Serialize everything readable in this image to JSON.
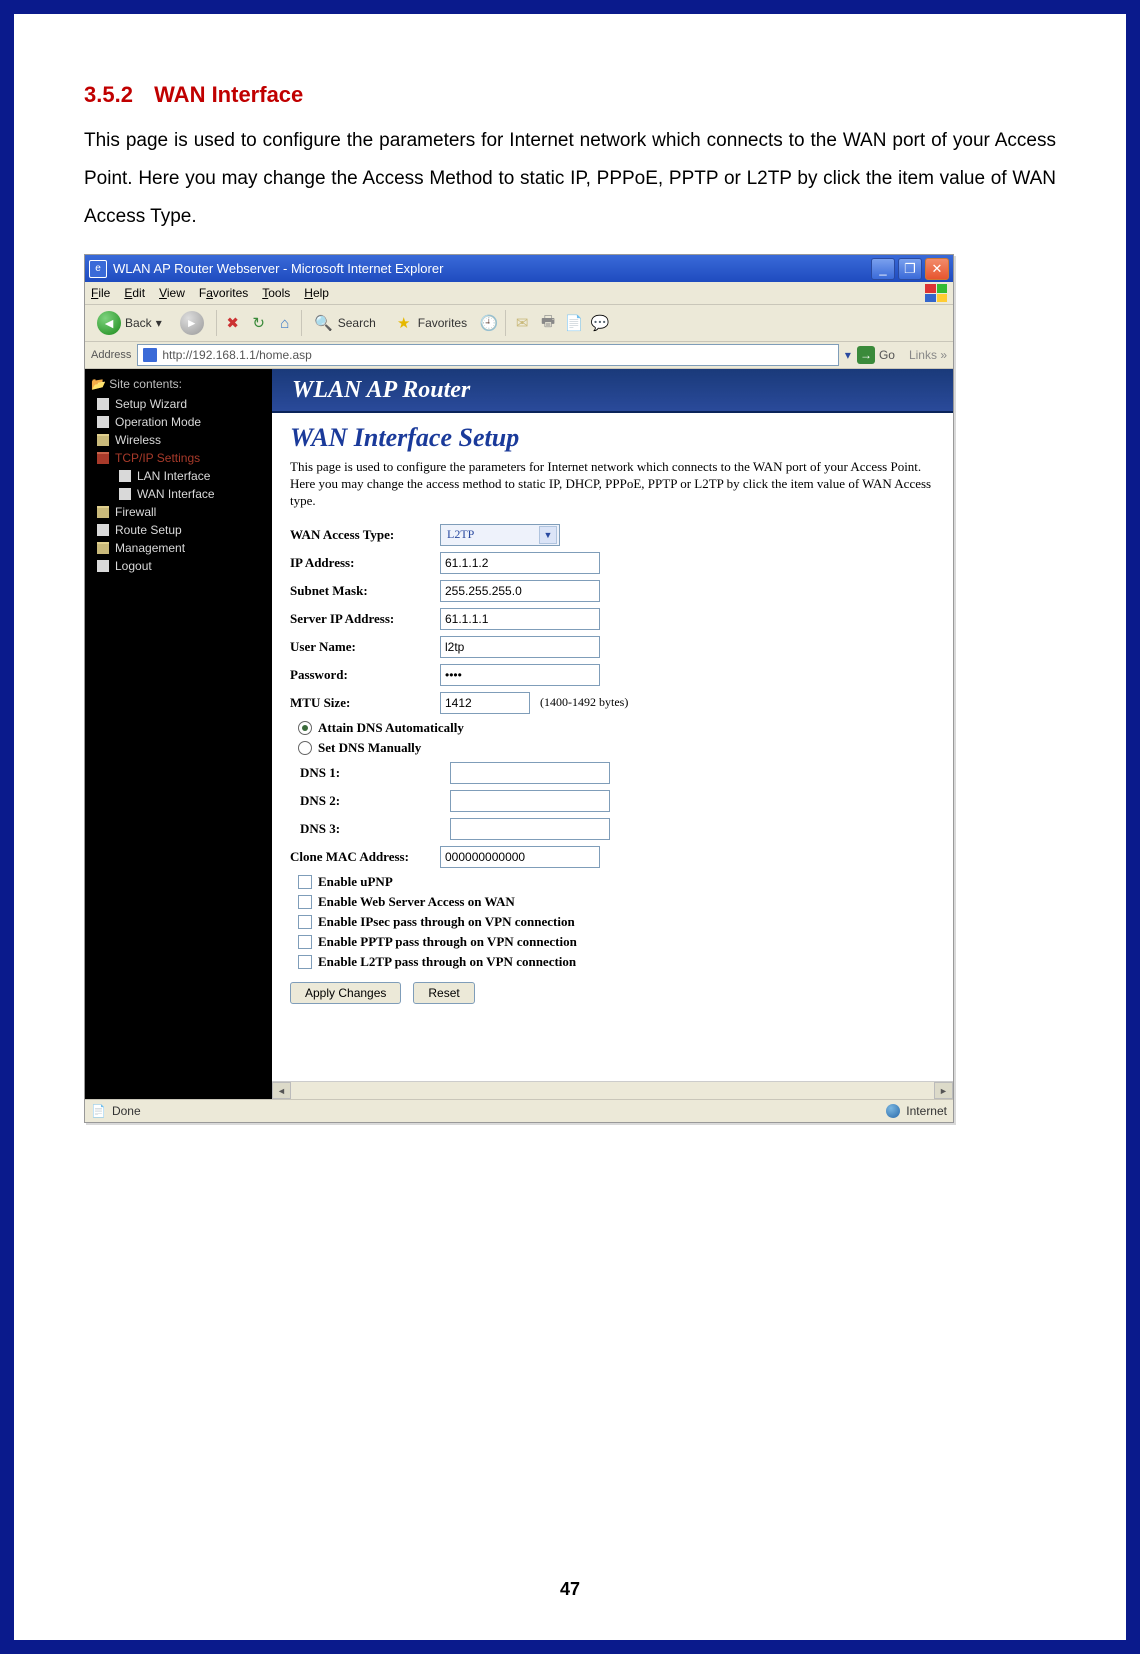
{
  "section": {
    "number": "3.5.2",
    "title": "WAN Interface"
  },
  "intro": "This page is used to configure the parameters for Internet network which connects to the WAN port of your Access Point. Here you may change the Access Method to static IP, PPPoE, PPTP or L2TP by click the item value of WAN Access Type.",
  "page_number": "47",
  "ie": {
    "title": "WLAN AP Router Webserver - Microsoft Internet Explorer",
    "menus": [
      "File",
      "Edit",
      "View",
      "Favorites",
      "Tools",
      "Help"
    ],
    "back": "Back",
    "search": "Search",
    "favorites": "Favorites",
    "addr_label": "Address",
    "addr_value": "http://192.168.1.1/home.asp",
    "go": "Go",
    "links": "Links",
    "status_done": "Done",
    "status_zone": "Internet"
  },
  "side": {
    "title": "Site contents:",
    "items": [
      {
        "label": "Setup Wizard",
        "type": "page",
        "sub": false
      },
      {
        "label": "Operation Mode",
        "type": "page",
        "sub": false
      },
      {
        "label": "Wireless",
        "type": "folder",
        "sub": false
      },
      {
        "label": "TCP/IP Settings",
        "type": "folder-open",
        "sub": false
      },
      {
        "label": "LAN Interface",
        "type": "page",
        "sub": true
      },
      {
        "label": "WAN Interface",
        "type": "page",
        "sub": true
      },
      {
        "label": "Firewall",
        "type": "folder",
        "sub": false
      },
      {
        "label": "Route Setup",
        "type": "page",
        "sub": false
      },
      {
        "label": "Management",
        "type": "folder",
        "sub": false
      },
      {
        "label": "Logout",
        "type": "page",
        "sub": false
      }
    ]
  },
  "banner": "WLAN AP Router",
  "panel": {
    "title": "WAN Interface Setup",
    "desc": "This page is used to configure the parameters for Internet network which connects to the WAN port of your Access Point. Here you may change the access method to static IP, DHCP, PPPoE, PPTP or L2TP by click the item value of WAN Access type.",
    "fields": {
      "wan_access_type": {
        "label": "WAN Access Type:",
        "value": "L2TP"
      },
      "ip_address": {
        "label": "IP Address:",
        "value": "61.1.1.2"
      },
      "subnet_mask": {
        "label": "Subnet Mask:",
        "value": "255.255.255.0"
      },
      "server_ip": {
        "label": "Server IP Address:",
        "value": "61.1.1.1"
      },
      "user_name": {
        "label": "User Name:",
        "value": "l2tp"
      },
      "password": {
        "label": "Password:",
        "value": "••••"
      },
      "mtu": {
        "label": "MTU Size:",
        "value": "1412",
        "hint": "(1400-1492 bytes)"
      },
      "dns_auto": "Attain DNS Automatically",
      "dns_manual": "Set DNS Manually",
      "dns1": {
        "label": "DNS 1:",
        "value": ""
      },
      "dns2": {
        "label": "DNS 2:",
        "value": ""
      },
      "dns3": {
        "label": "DNS 3:",
        "value": ""
      },
      "clone_mac": {
        "label": "Clone MAC Address:",
        "value": "000000000000"
      },
      "checks": [
        "Enable uPNP",
        "Enable Web Server Access on WAN",
        "Enable IPsec pass through on VPN connection",
        "Enable PPTP pass through on VPN connection",
        "Enable L2TP pass through on VPN connection"
      ],
      "apply": "Apply Changes",
      "reset": "Reset"
    }
  }
}
